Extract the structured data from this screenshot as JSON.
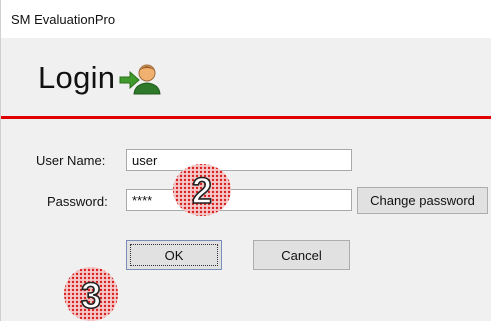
{
  "window": {
    "title": "SM EvaluationPro"
  },
  "header": {
    "heading": "Login",
    "icon": "user-arrow-icon"
  },
  "form": {
    "username_label": "User Name:",
    "username_value": "user",
    "password_label": "Password:",
    "password_value": "****",
    "change_password_label": "Change password"
  },
  "buttons": {
    "ok_label": "OK",
    "cancel_label": "Cancel"
  },
  "annotations": {
    "badge_2": "2",
    "badge_3": "3"
  },
  "colors": {
    "accent_line": "#e00000",
    "badge": "#d81e1e"
  }
}
